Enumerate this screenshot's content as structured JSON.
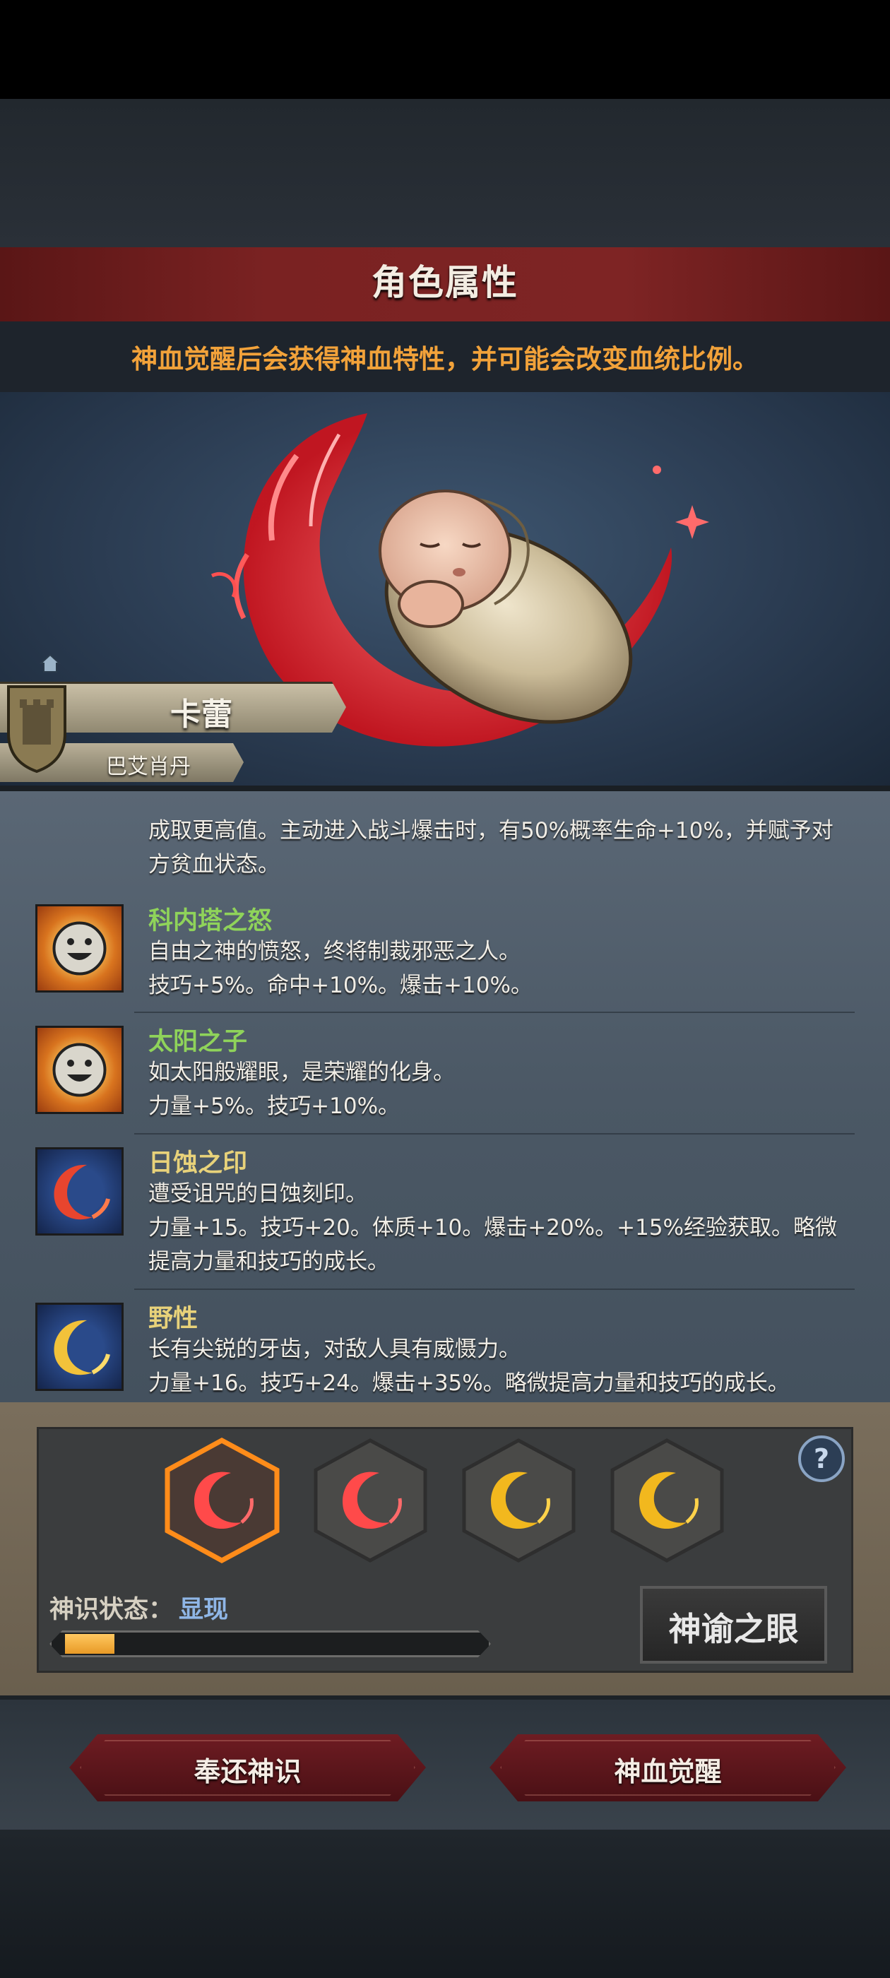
{
  "header": {
    "title": "角色属性",
    "subtitle": "神血觉醒后会获得神血特性，并可能会改变血统比例。"
  },
  "character": {
    "name": "卡蕾",
    "house": "巴艾肖丹"
  },
  "traits": {
    "partial_lines": [
      "成取更高值。主动进入战斗爆击时，有50%概率生命+10%，并赋予对",
      "方贫血状态。"
    ],
    "items": [
      {
        "name": "科内塔之怒",
        "name_color": "#8fd35a",
        "icon": "smiley-sun-icon",
        "lines": [
          "自由之神的愤怒，终将制裁邪恶之人。",
          "技巧+5%。命中+10%。爆击+10%。"
        ]
      },
      {
        "name": "太阳之子",
        "name_color": "#8fd35a",
        "icon": "smiley-sun-icon",
        "lines": [
          "如太阳般耀眼，是荣耀的化身。",
          "力量+5%。技巧+10%。"
        ]
      },
      {
        "name": "日蚀之印",
        "name_color": "#e8d27a",
        "icon": "red-eclipse-icon",
        "lines": [
          "遭受诅咒的日蚀刻印。",
          "力量+15。技巧+20。体质+10。爆击+20%。+15%经验获取。略微",
          "提高力量和技巧的成长。"
        ]
      },
      {
        "name": "野性",
        "name_color": "#e8d27a",
        "icon": "gold-crescent-icon",
        "lines": [
          "长有尖锐的牙齿，对敌人具有威慑力。",
          "力量+16。技巧+24。爆击+35%。略微提高力量和技巧的成长。"
        ]
      }
    ]
  },
  "awakening": {
    "slots": [
      {
        "icon": "red-crescent-icon",
        "selected": true
      },
      {
        "icon": "red-crescent-icon",
        "selected": false
      },
      {
        "icon": "gold-crescent-icon",
        "selected": false
      },
      {
        "icon": "gold-crescent-icon",
        "selected": false
      }
    ],
    "status_label": "神识状态：",
    "status_value": "显现",
    "progress": 0.12,
    "oracle_button": "神谕之眼"
  },
  "actions": {
    "return_button": "奉还神识",
    "awaken_button": "神血觉醒"
  },
  "colors": {
    "accent_orange": "#f2a23a",
    "status_blue": "#8fb6e6",
    "button_red": "#6e1c22"
  }
}
